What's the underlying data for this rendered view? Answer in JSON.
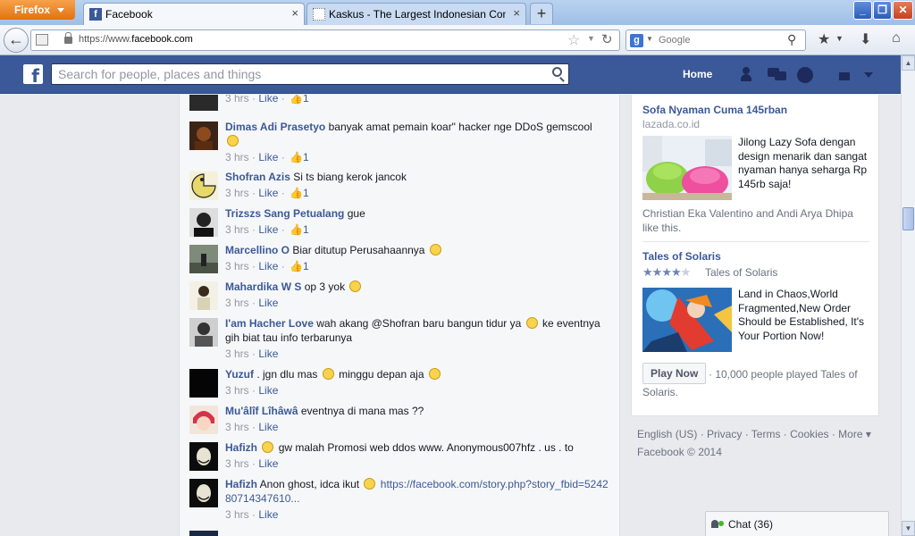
{
  "browser": {
    "app_button": "Firefox",
    "tabs": [
      {
        "title": "Facebook"
      },
      {
        "title": "Kaskus - The Largest Indonesian Commu..."
      }
    ],
    "new_tab": "+",
    "url_prefix": "https://www.",
    "url_domain": "facebook.com",
    "search_engine": "Google",
    "search_placeholder": "Google",
    "icons": [
      "back-icon",
      "page-icon",
      "lock-icon",
      "star-icon",
      "reload-icon",
      "google-icon",
      "magnifier-icon",
      "bookmarks-icon",
      "download-icon",
      "home-icon",
      "minimize-icon",
      "maximize-icon",
      "close-icon"
    ]
  },
  "facebook": {
    "logo": "f",
    "search_placeholder": "Search for people, places and things",
    "home_label": "Home",
    "brand_color": "#3b5998"
  },
  "comments": [
    {
      "author": "",
      "text": "",
      "time": "3 hrs",
      "like": "Like",
      "likes": "1"
    },
    {
      "author": "Dimas Adi Prasetyo",
      "text": "banyak amat pemain koar\" hacker nge DDoS gemscool",
      "time": "3 hrs",
      "like": "Like",
      "likes": "1"
    },
    {
      "author": "Shofran Azis",
      "text": "Si ts biang kerok jancok",
      "time": "3 hrs",
      "like": "Like",
      "likes": "1"
    },
    {
      "author": "Trizszs Sang Petualang",
      "text": "gue",
      "time": "3 hrs",
      "like": "Like",
      "likes": "1"
    },
    {
      "author": "Marcellino O",
      "text": "Biar ditutup Perusahaannya",
      "time": "3 hrs",
      "like": "Like",
      "likes": "1"
    },
    {
      "author": "Mahardika W S",
      "text": "op 3 yok",
      "time": "3 hrs",
      "like": "Like",
      "likes": ""
    },
    {
      "author": "I'am Hacher Love",
      "text": "wah akang @Shofran baru bangun tidur ya",
      "text2": "ke eventnya gih biat tau info terbarunya",
      "time": "3 hrs",
      "like": "Like",
      "likes": ""
    },
    {
      "author": "Yuzuf",
      "text": ". jgn dlu mas",
      "text2": "minggu depan aja",
      "time": "3 hrs",
      "like": "Like",
      "likes": ""
    },
    {
      "author": "Mu'âlîf Lîhâwâ",
      "text": "eventnya di mana mas ??",
      "time": "3 hrs",
      "like": "Like",
      "likes": ""
    },
    {
      "author": "Hafizh",
      "text": "gw malah Promosi web ddos www. Anonymous007hfz . us . to",
      "time": "3 hrs",
      "like": "Like",
      "likes": ""
    },
    {
      "author": "Hafizh",
      "text": "Anon ghost, idca ikut",
      "link": "https://facebook.com/story.php?story_fbid=524280714347610...",
      "time": "3 hrs",
      "like": "Like",
      "likes": ""
    }
  ],
  "ads": {
    "ad1": {
      "title": "Sofa Nyaman Cuma 145rban",
      "domain": "lazada.co.id",
      "text": "Jilong Lazy Sofa dengan design menarik dan sangat nyaman hanya seharga Rp 145rb saja!",
      "social": "Christian Eka Valentino and Andi Arya Dhipa like this."
    },
    "ad2": {
      "title": "Tales of Solaris",
      "rating": 3.5,
      "rating_max": 5,
      "game_name": "Tales of Solaris",
      "text": "Land in Chaos,World Fragmented,New Order Should be Established, It's Your Portion Now!",
      "button": "Play Now",
      "play_count": "· 10,000 people played Tales of Solaris."
    }
  },
  "footer": {
    "line1": "English (US) · Privacy · Terms · Cookies · More ▾",
    "line2": "Facebook © 2014"
  },
  "chat": {
    "label": "Chat (36)"
  }
}
